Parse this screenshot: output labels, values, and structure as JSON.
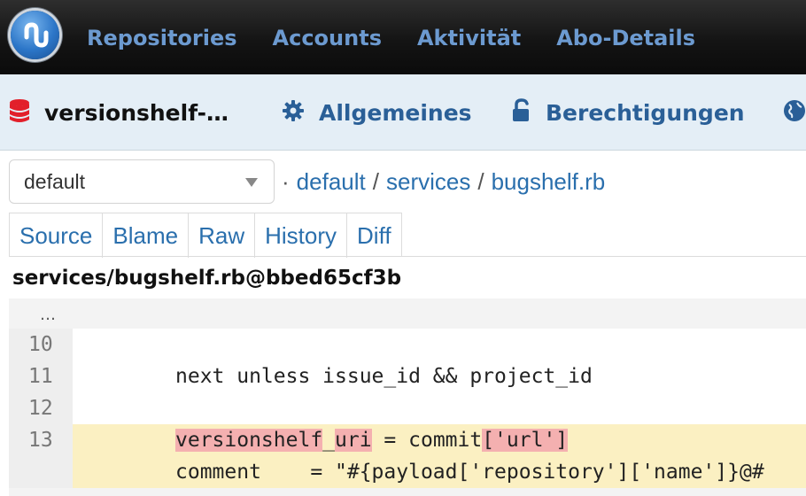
{
  "topnav": {
    "items": [
      "Repositories",
      "Accounts",
      "Aktivität",
      "Abo-Details"
    ]
  },
  "repo": {
    "title": "versionshelf-…",
    "settings_label": "Allgemeines",
    "permissions_label": "Berechtigungen"
  },
  "branch": {
    "selected": "default"
  },
  "breadcrumb": [
    "default",
    "services",
    "bugshelf.rb"
  ],
  "file_tabs": [
    "Source",
    "Blame",
    "Raw",
    "History",
    "Diff"
  ],
  "file_path": "services/bugshelf.rb@bbed65cf3b",
  "code": {
    "ellipsis": "…",
    "lines": [
      {
        "num": "10",
        "text": ""
      },
      {
        "num": "11",
        "text": "next unless issue_id && project_id"
      },
      {
        "num": "12",
        "text": ""
      },
      {
        "num": "13",
        "parts": [
          "versionshelf",
          "_",
          "uri",
          " = commit",
          "['url']"
        ]
      },
      {
        "num": "",
        "text": "comment    = \"#{payload['repository']['name']}@#"
      }
    ]
  },
  "colors": {
    "nav_link": "#6c9ad0",
    "sub_link": "#2a5f97",
    "link": "#2a6fad",
    "highlight_line": "#fbf0c2",
    "highlight_token": "#f4b0b0"
  }
}
